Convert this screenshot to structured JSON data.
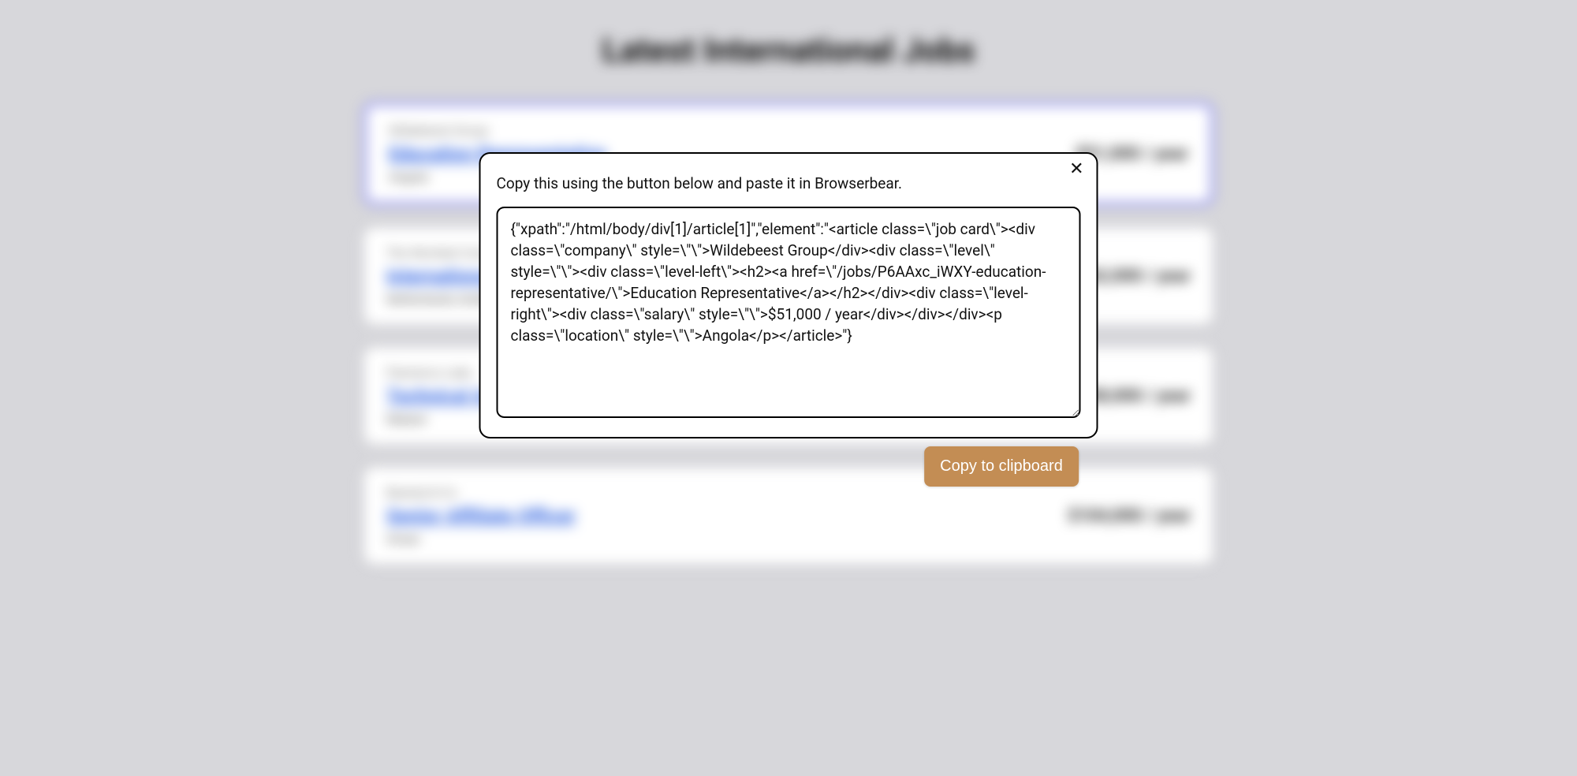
{
  "page": {
    "heading": "Latest International Jobs"
  },
  "jobs": [
    {
      "company": "Wildebeest Group",
      "title": "Education Representative",
      "salary": "$51,000 / year",
      "location": "Angola"
    },
    {
      "company": "The Wombat Company",
      "title": "International Sales Lead",
      "salary": "$62,000 / year",
      "location": "Netherlands Antilles"
    },
    {
      "company": "Flamenco Labs",
      "title": "Technical Account Manager",
      "salary": "$58,000 / year",
      "location": "Malawi"
    },
    {
      "company": "Basenji & Co",
      "title": "Senior Affiliate Officer",
      "salary": "$104,000 / year",
      "location": "Oman"
    }
  ],
  "modal": {
    "instruction": "Copy this using the button below and paste it in Browserbear.",
    "textarea_value": "{\"xpath\":\"/html/body/div[1]/article[1]\",\"element\":\"<article class=\\\"job card\\\"><div class=\\\"company\\\" style=\\\"\\\">Wildebeest Group</div><div class=\\\"level\\\" style=\\\"\\\"><div class=\\\"level-left\\\"><h2><a href=\\\"/jobs/P6AAxc_iWXY-education-representative/\\\">Education Representative</a></h2></div><div class=\\\"level-right\\\"><div class=\\\"salary\\\" style=\\\"\\\">$51,000 / year</div></div></div><p class=\\\"location\\\" style=\\\"\\\">Angola</p></article>\"}",
    "close_label": "✕",
    "copy_button_label": "Copy to clipboard"
  }
}
